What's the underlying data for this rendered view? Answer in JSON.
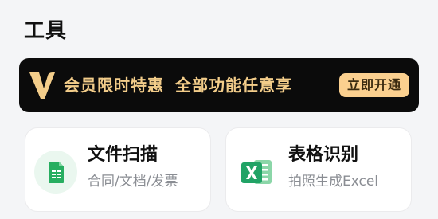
{
  "section": {
    "title": "工具"
  },
  "vip_banner": {
    "text_part1": "会员限时特惠",
    "text_part2": "全部功能任意享",
    "button_label": "立即开通",
    "icon": "vip-v-icon",
    "colors": {
      "background": "#0b0b0b",
      "gold": "#f3cd8a",
      "button": "#fbd08f"
    }
  },
  "tools": [
    {
      "title": "文件扫描",
      "subtitle": "合同/文档/发票",
      "icon": "document-scan-icon",
      "color": "#27ae60"
    },
    {
      "title": "表格识别",
      "subtitle": "拍照生成Excel",
      "icon": "excel-icon",
      "color": "#21a366"
    }
  ]
}
